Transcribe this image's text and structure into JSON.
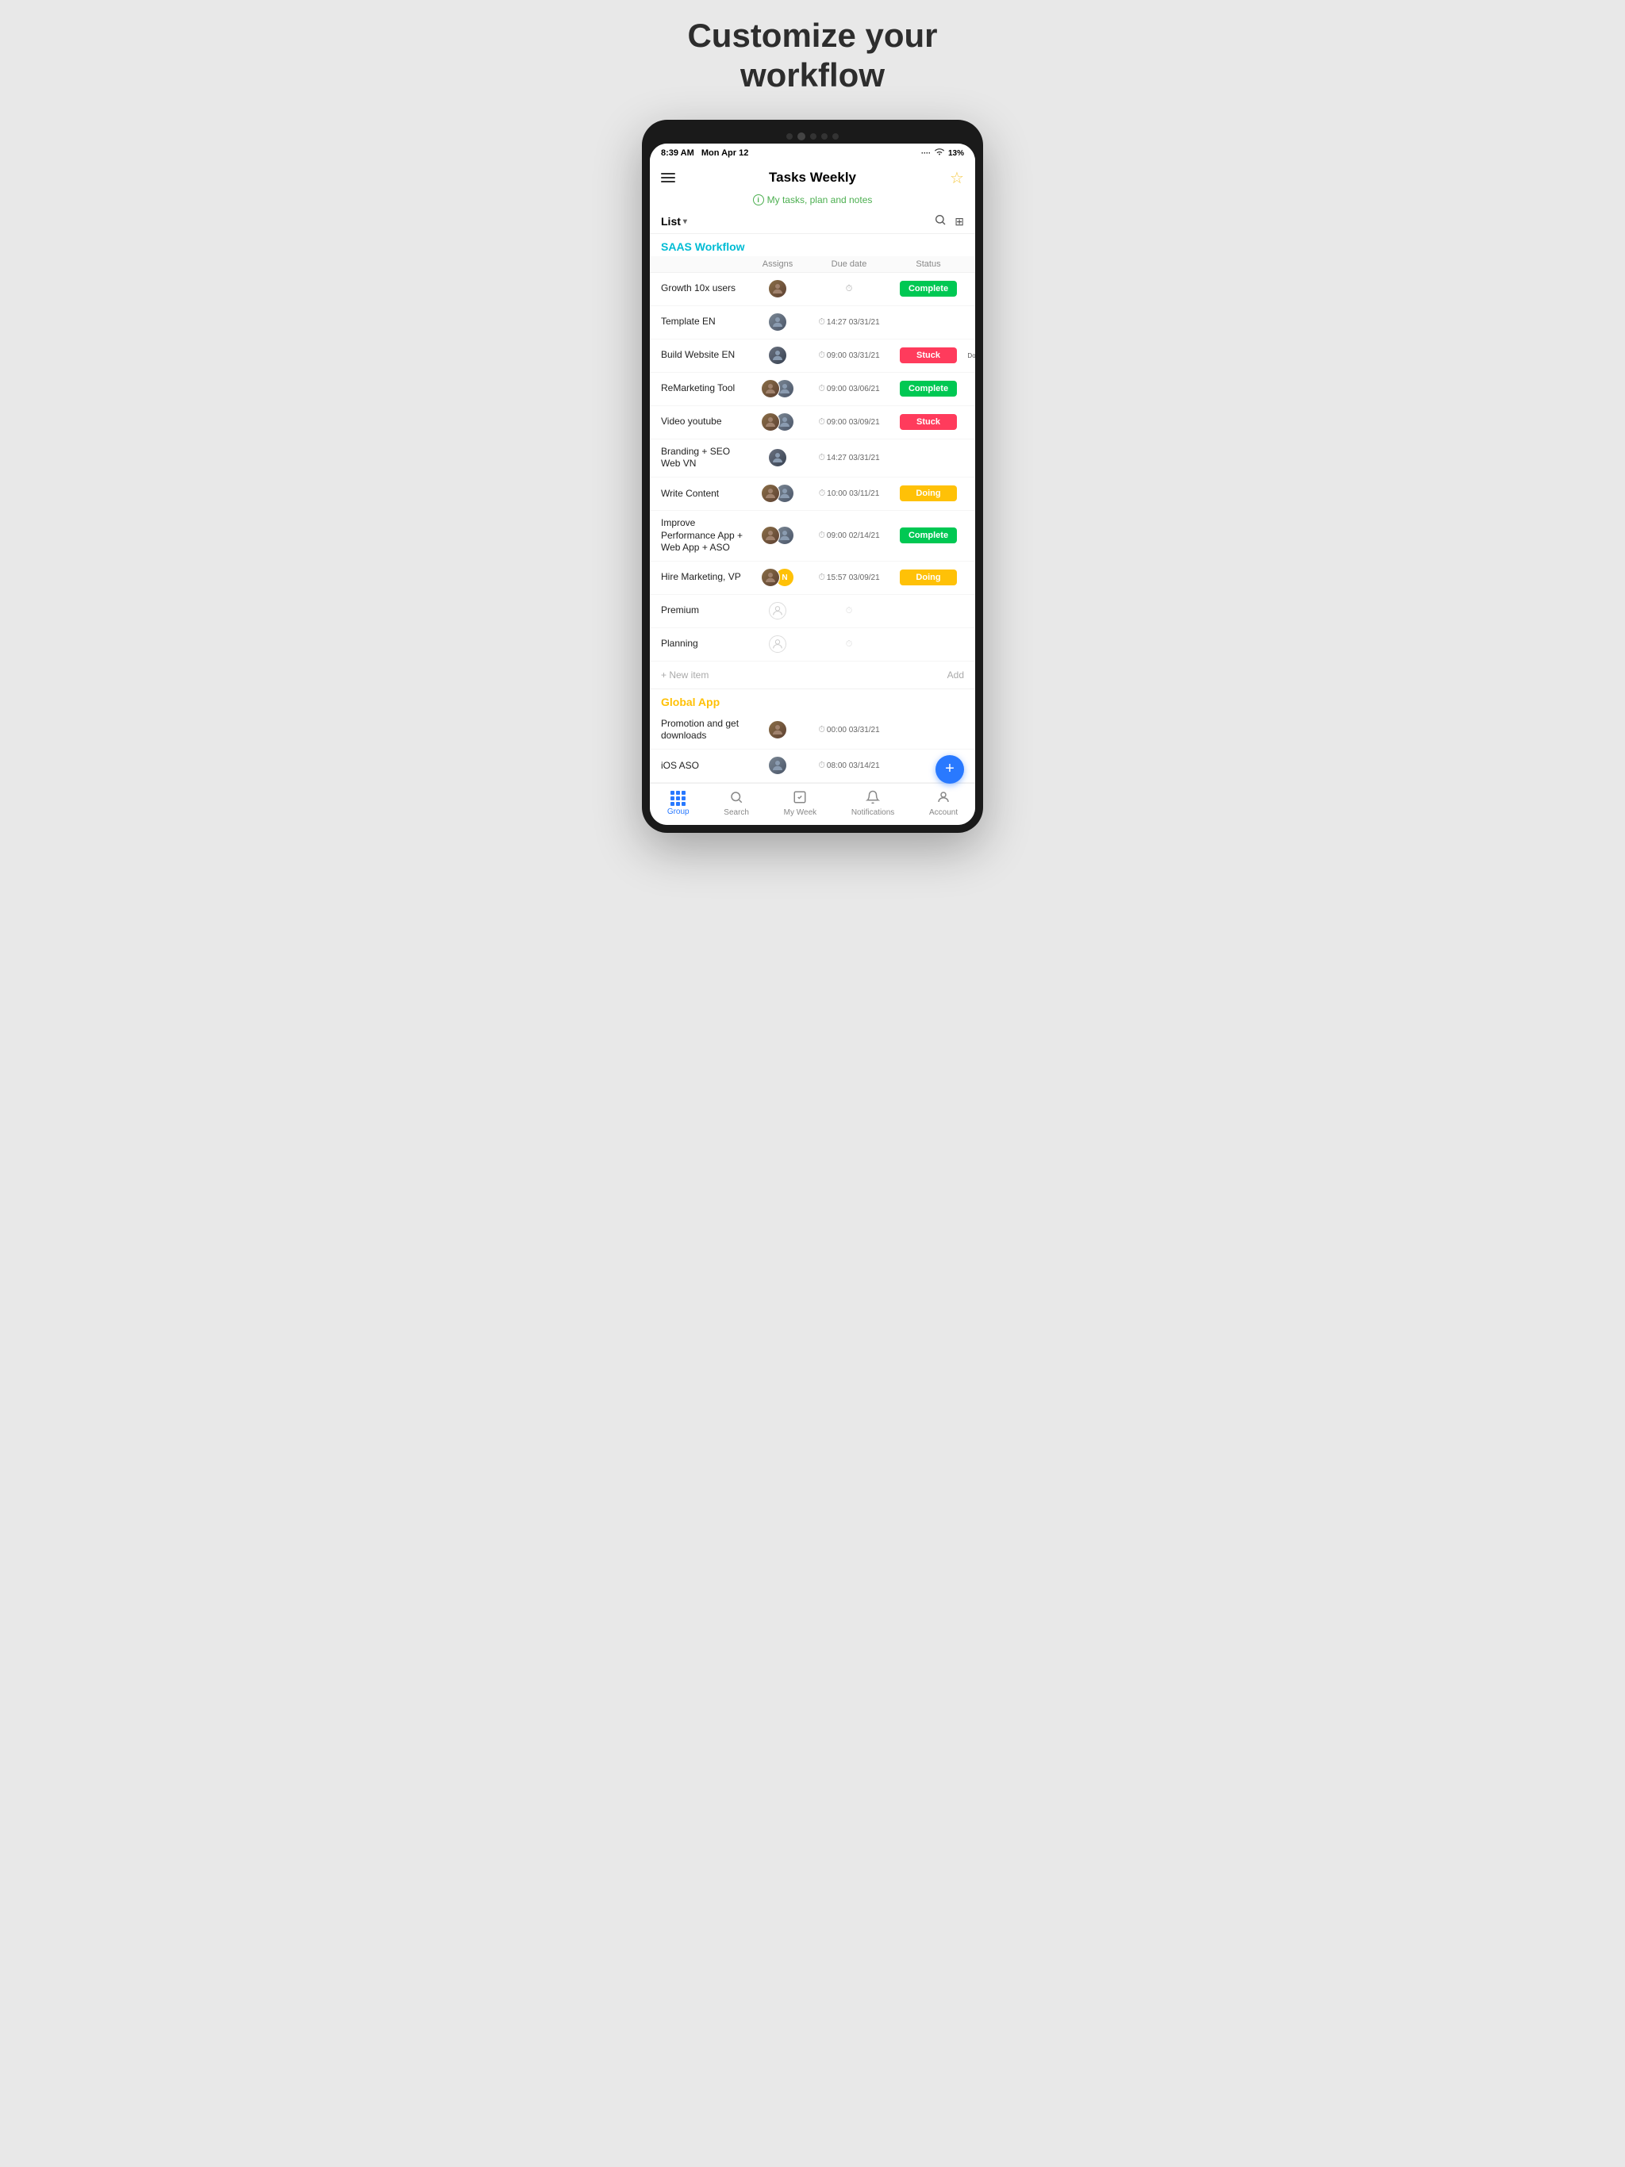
{
  "headline": "Customize your\nworkflow",
  "status_bar": {
    "time": "8:39 AM",
    "date": "Mon Apr 12",
    "battery": "13%"
  },
  "app": {
    "title": "Tasks Weekly",
    "subtitle": "My tasks, plan and notes",
    "list_label": "List"
  },
  "saas_section": {
    "label": "SAAS Workflow",
    "columns": {
      "name": "",
      "assigns": "Assigns",
      "due_date": "Due date",
      "status": "Status"
    },
    "tasks": [
      {
        "name": "Growth 10x users",
        "assigns": 1,
        "due_date": "",
        "status": "Complete",
        "status_type": "complete"
      },
      {
        "name": "Template EN",
        "assigns": 1,
        "due_date": "14:27 03/31/21",
        "status": "",
        "status_type": "empty"
      },
      {
        "name": "Build Website EN",
        "assigns": 1,
        "due_date": "09:00 03/31/21",
        "status": "Stuck",
        "status_type": "stuck",
        "side": "Doanh"
      },
      {
        "name": "ReMarketing Tool",
        "assigns": 2,
        "due_date": "09:00 03/06/21",
        "status": "Complete",
        "status_type": "complete"
      },
      {
        "name": "Video youtube",
        "assigns": 2,
        "due_date": "09:00 03/09/21",
        "status": "Stuck",
        "status_type": "stuck"
      },
      {
        "name": "Branding + SEO Web VN",
        "assigns": 1,
        "due_date": "14:27 03/31/21",
        "status": "",
        "status_type": "empty"
      },
      {
        "name": "Write Content",
        "assigns": 2,
        "due_date": "10:00 03/11/21",
        "status": "Doing",
        "status_type": "doing"
      },
      {
        "name": "Improve Performance App + Web App + ASO",
        "assigns": 2,
        "due_date": "09:00 02/14/21",
        "status": "Complete",
        "status_type": "complete"
      },
      {
        "name": "Hire Marketing, VP",
        "assigns": 2,
        "due_date": "15:57 03/09/21",
        "status": "Doing",
        "status_type": "doing",
        "has_N": true
      },
      {
        "name": "Premium",
        "assigns": 0,
        "due_date": "",
        "status": "",
        "status_type": "empty"
      },
      {
        "name": "Planning",
        "assigns": 0,
        "due_date": "",
        "status": "",
        "status_type": "empty"
      }
    ],
    "new_item_label": "+ New item",
    "add_label": "Add"
  },
  "global_section": {
    "label": "Global App",
    "tasks": [
      {
        "name": "Promotion and get downloads",
        "assigns": 1,
        "due_date": "00:00 03/31/21",
        "status": "",
        "status_type": "empty"
      },
      {
        "name": "iOS ASO",
        "assigns": 1,
        "due_date": "08:00 03/14/21",
        "status": "",
        "status_type": "empty"
      }
    ]
  },
  "bottom_nav": {
    "items": [
      {
        "label": "Group",
        "icon": "grid",
        "active": true
      },
      {
        "label": "Search",
        "icon": "search",
        "active": false
      },
      {
        "label": "My Week",
        "icon": "checkbox",
        "active": false
      },
      {
        "label": "Notifications",
        "icon": "bell",
        "active": false
      },
      {
        "label": "Account",
        "icon": "person",
        "active": false
      }
    ]
  },
  "fab": {
    "label": "+"
  }
}
